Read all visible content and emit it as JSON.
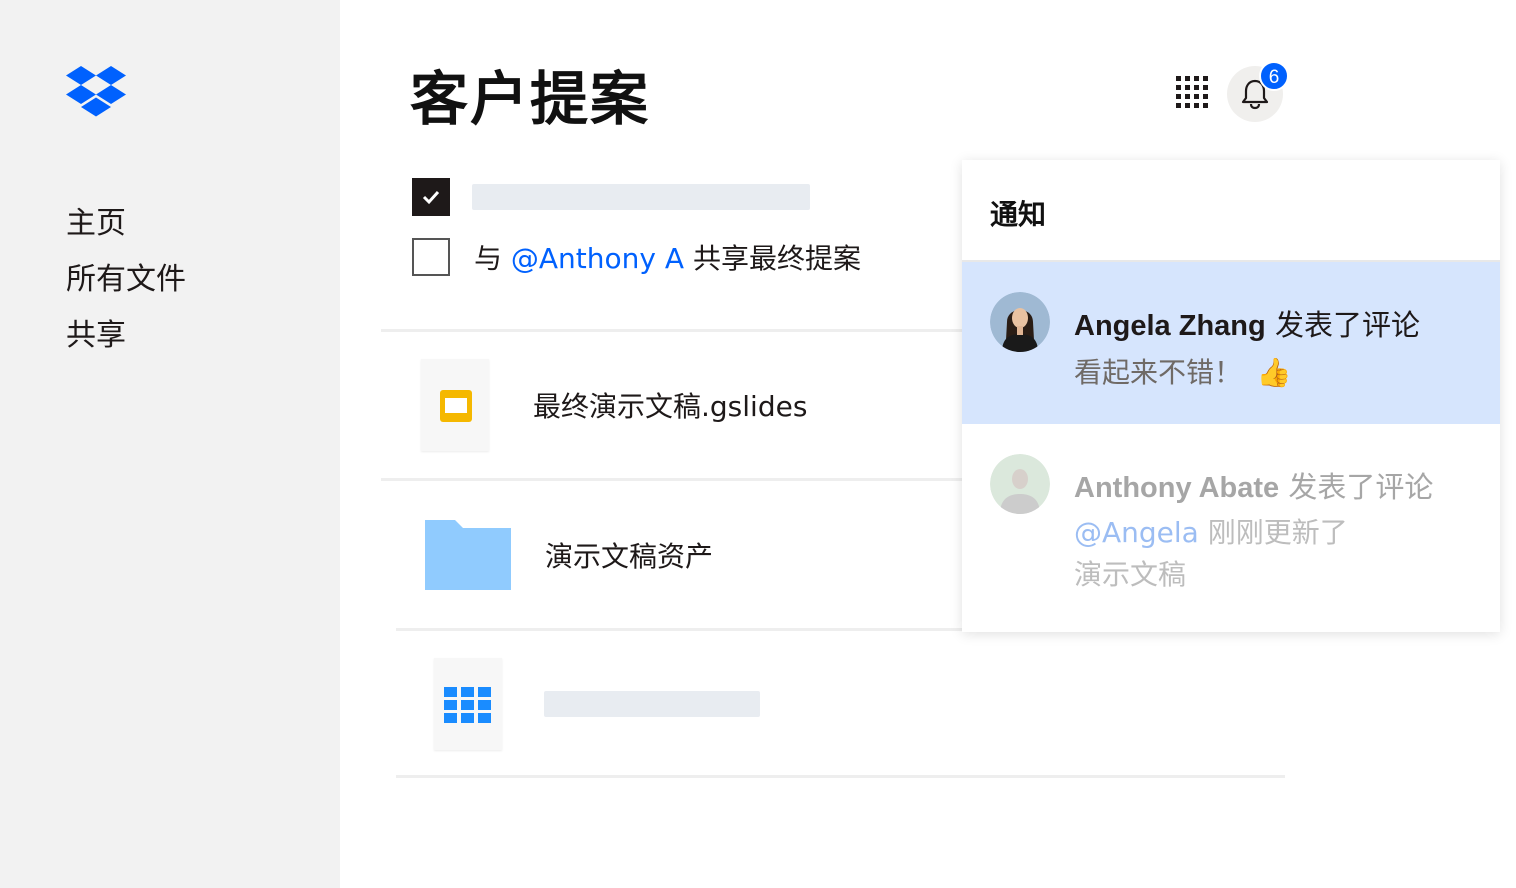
{
  "sidebar": {
    "items": [
      {
        "label": "主页"
      },
      {
        "label": "所有文件"
      },
      {
        "label": "共享"
      }
    ]
  },
  "header": {
    "title": "客户提案",
    "notification_count": "6"
  },
  "tasks": [
    {
      "checked": true,
      "text": ""
    },
    {
      "checked": false,
      "prefix": "与 ",
      "mention": "@Anthony A",
      "suffix": " 共享最终提案"
    }
  ],
  "files": [
    {
      "name": "最终演示文稿.gslides",
      "icon": "slides-icon"
    },
    {
      "name": "演示文稿资产",
      "icon": "folder-icon"
    },
    {
      "name": "",
      "icon": "spreadsheet-icon"
    }
  ],
  "notifications": {
    "header": "通知",
    "items": [
      {
        "author": "Angela Zhang",
        "action": " 发表了评论",
        "message": "看起来不错！",
        "emoji": "👍"
      },
      {
        "author": "Anthony Abate",
        "action": " 发表了评论",
        "mention": "@Angela",
        "message_line1": " 刚刚更新了",
        "message_line2": "演示文稿"
      }
    ]
  },
  "colors": {
    "accent": "#0061fe",
    "sidebar_bg": "#f2f2f2",
    "active_notification_bg": "#d6e5fd",
    "folder": "#90cbfe",
    "slides": "#f5b800"
  }
}
